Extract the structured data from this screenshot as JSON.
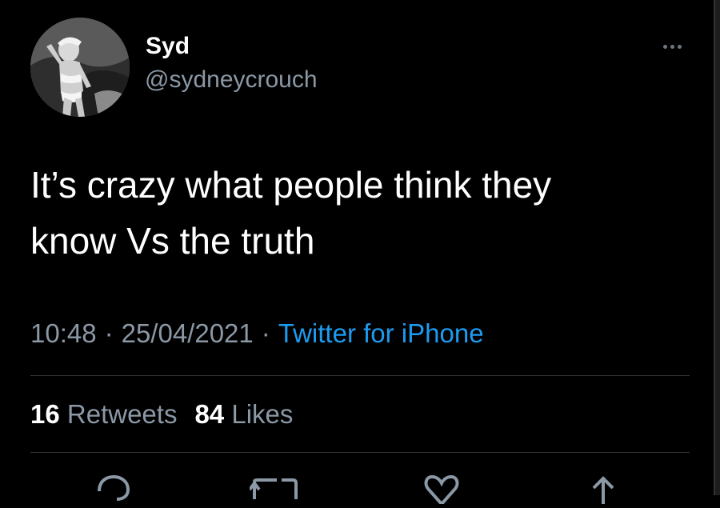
{
  "tweet": {
    "display_name": "Syd",
    "handle": "@sydneycrouch",
    "text_line1": "It’s crazy what people think they",
    "text_line2": "know Vs the truth",
    "time": "10:48",
    "date": "25/04/2021",
    "separator": "·",
    "source": "Twitter for iPhone"
  },
  "stats": {
    "retweets_count": "16",
    "retweets_label": "Retweets",
    "likes_count": "84",
    "likes_label": "Likes"
  },
  "icons": {
    "more": "more-horizontal-icon",
    "reply": "reply-icon",
    "retweet": "retweet-icon",
    "like": "heart-icon",
    "share": "share-icon"
  },
  "colors": {
    "background": "#000000",
    "primary_text": "#ffffff",
    "secondary_text": "#8b98a5",
    "link": "#1d9bf0",
    "divider": "#2f3336"
  }
}
